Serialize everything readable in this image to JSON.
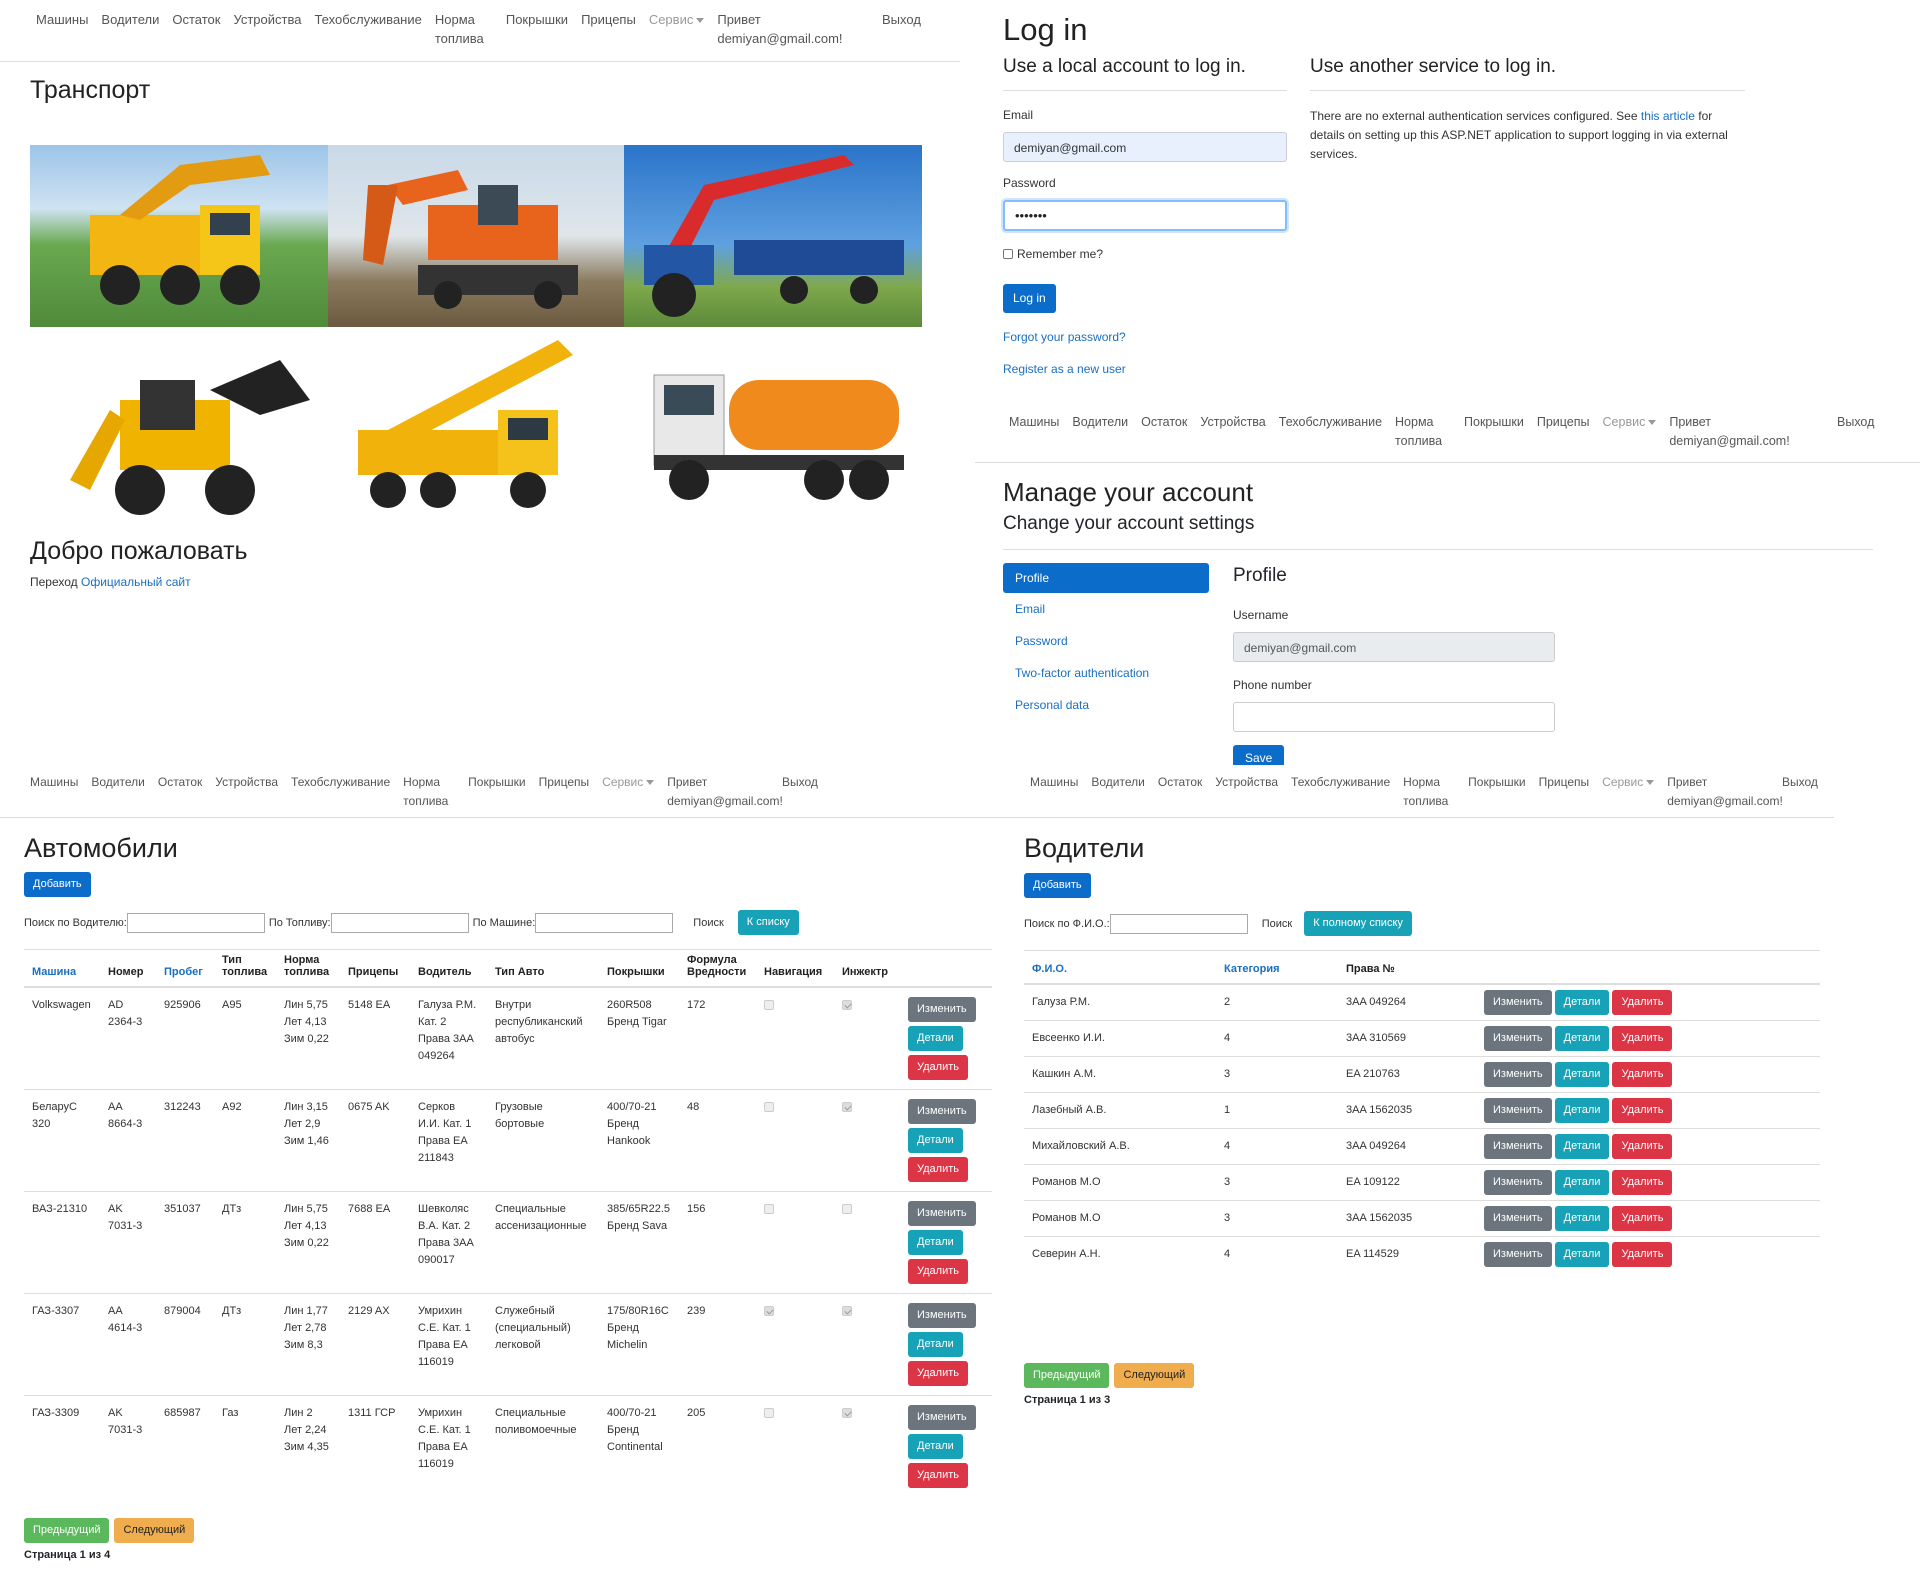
{
  "nav": {
    "items": [
      "Машины",
      "Водители",
      "Остаток",
      "Устройства",
      "Техобслуживание",
      "Норма топлива",
      "Покрышки",
      "Прицепы"
    ],
    "service": "Сервис",
    "hello": "Привет demiyan@gmail.com!",
    "logout": "Выход"
  },
  "home": {
    "title": "Транспорт",
    "welcome": "Добро пожаловать",
    "goto_text": "Переход",
    "goto_link": "Официальный сайт",
    "photos": [
      "excavator-truck",
      "orange-excavator",
      "tractor-trailer",
      "backhoe-loader",
      "mobile-crane",
      "vacuum-truck"
    ]
  },
  "login": {
    "title": "Log in",
    "local_heading": "Use a local account to log in.",
    "external_heading": "Use another service to log in.",
    "external_text_1": "There are no external authentication services configured. See",
    "external_link": "this article",
    "external_text_2": "for details on setting up this ASP.NET application to support logging in via external services.",
    "email_label": "Email",
    "email_value": "demiyan@gmail.com",
    "password_label": "Password",
    "password_value": "•••••••",
    "remember": "Remember me?",
    "login_button": "Log in",
    "forgot": "Forgot your password?",
    "register": "Register as a new user"
  },
  "manage": {
    "title": "Manage your account",
    "subtitle": "Change your account settings",
    "menu": [
      "Profile",
      "Email",
      "Password",
      "Two-factor authentication",
      "Personal data"
    ],
    "section_title": "Profile",
    "username_label": "Username",
    "username_value": "demiyan@gmail.com",
    "phone_label": "Phone number",
    "phone_value": "",
    "save": "Save"
  },
  "cars": {
    "title": "Автомобили",
    "add": "Добавить",
    "search_driver": "Поиск по Водителю:",
    "search_fuel": "По Топливу:",
    "search_car": "По Машине:",
    "search_btn": "Поиск",
    "to_list": "К списку",
    "headers": [
      "Машина",
      "Номер",
      "Пробег",
      "Тип топлива",
      "Норма топлива",
      "Прицепы",
      "Водитель",
      "Тип Авто",
      "Покрышки",
      "Формула Вредности",
      "Навигация",
      "Инжектр"
    ],
    "rows": [
      {
        "car": "Volkswagen",
        "number": "AD 2364-3",
        "mileage": "925906",
        "fuel": "A95",
        "norm": [
          "Лин 5,75",
          "Лет 4,13",
          "Зим 0,22"
        ],
        "trailer": "5148 EA",
        "driver": "Галуза Р.М. Кат. 2 Права 3AA 049264",
        "type": "Внутри республиканский автобус",
        "tires": "260R508 Бренд Tigar",
        "formula": "172",
        "nav": false,
        "inj": true
      },
      {
        "car": "БеларуС 320",
        "number": "AA 8664-3",
        "mileage": "312243",
        "fuel": "A92",
        "norm": [
          "Лин 3,15",
          "Лет 2,9",
          "Зим 1,46"
        ],
        "trailer": "0675 AK",
        "driver": "Серков И.И. Кат. 1 Права EA 211843",
        "type": "Грузовые бортовые",
        "tires": "400/70-21 Бренд Hankook",
        "formula": "48",
        "nav": false,
        "inj": true
      },
      {
        "car": "ВАЗ-21310",
        "number": "AK 7031-3",
        "mileage": "351037",
        "fuel": "ДТз",
        "norm": [
          "Лин 5,75",
          "Лет 4,13",
          "Зим 0,22"
        ],
        "trailer": "7688 EA",
        "driver": "Шевколяс В.А. Кат. 2 Права 3AA 090017",
        "type": "Специальные ассенизационные",
        "tires": "385/65R22.5 Бренд Sava",
        "formula": "156",
        "nav": false,
        "inj": false
      },
      {
        "car": "ГАЗ-3307",
        "number": "AA 4614-3",
        "mileage": "879004",
        "fuel": "ДТз",
        "norm": [
          "Лин 1,77",
          "Лет 2,78",
          "Зим 8,3"
        ],
        "trailer": "2129 AX",
        "driver": "Умрихин С.Е. Кат. 1 Права EA 116019",
        "type": "Служебный (специальный) легковой",
        "tires": "175/80R16C Бренд Michelin",
        "formula": "239",
        "nav": true,
        "inj": true
      },
      {
        "car": "ГАЗ-3309",
        "number": "AK 7031-3",
        "mileage": "685987",
        "fuel": "Газ",
        "norm": [
          "Лин 2",
          "Лет 2,24",
          "Зим 4,35"
        ],
        "trailer": "1311 ГСР",
        "driver": "Умрихин С.Е. Кат. 1 Права EA 116019",
        "type": "Специальные поливомоечные",
        "tires": "400/70-21 Бренд Continental",
        "formula": "205",
        "nav": false,
        "inj": true
      }
    ],
    "row_buttons": [
      "Изменить",
      "Детали",
      "Удалить"
    ],
    "prev": "Предыдущий",
    "next": "Следующий",
    "page_info": "Страница 1 из 4"
  },
  "drivers": {
    "title": "Водители",
    "add": "Добавить",
    "search_label": "Поиск по Ф.И.О.:",
    "search_btn": "Поиск",
    "full_list": "К полному списку",
    "headers": [
      "Ф.И.О.",
      "Категория",
      "Права №"
    ],
    "rows": [
      {
        "name": "Галуза Р.М.",
        "cat": "2",
        "license": "3AA 049264"
      },
      {
        "name": "Евсеенко И.И.",
        "cat": "4",
        "license": "3AA 310569"
      },
      {
        "name": "Кашкин А.М.",
        "cat": "3",
        "license": "EA 210763"
      },
      {
        "name": "Лазебный А.В.",
        "cat": "1",
        "license": "3AA 1562035"
      },
      {
        "name": "Михайловский А.В.",
        "cat": "4",
        "license": "3AA 049264"
      },
      {
        "name": "Романов М.О",
        "cat": "3",
        "license": "EA 109122"
      },
      {
        "name": "Романов М.О",
        "cat": "3",
        "license": "3AA 1562035"
      },
      {
        "name": "Северин А.Н.",
        "cat": "4",
        "license": "EA 114529"
      }
    ],
    "row_buttons": [
      "Изменить",
      "Детали",
      "Удалить"
    ],
    "prev": "Предыдущий",
    "next": "Следующий",
    "page_info": "Страница 1 из 3"
  }
}
